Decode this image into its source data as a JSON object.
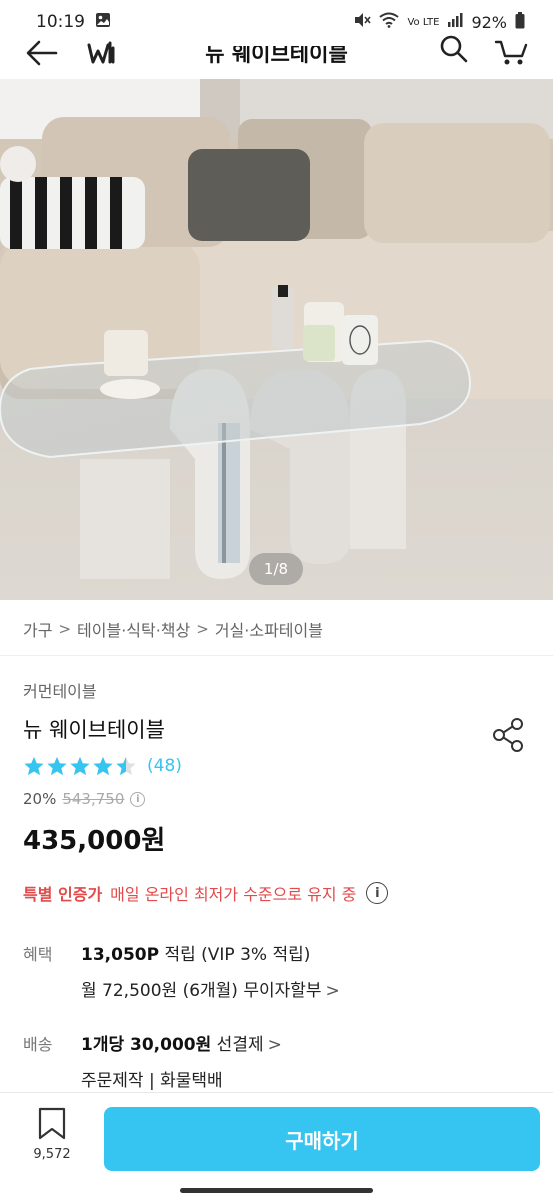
{
  "status_bar": {
    "time": "10:19",
    "network": "Vo LTE",
    "battery": "92%"
  },
  "header": {
    "title": "뉴 웨이브테이블",
    "icons": [
      "back-arrow-icon",
      "ohouse-logo-icon",
      "search-icon",
      "cart-icon"
    ]
  },
  "hero": {
    "pager": "1/8"
  },
  "breadcrumb": {
    "items": [
      "가구",
      "테이블·식탁·책상",
      "거실·소파테이블"
    ],
    "separator": ">"
  },
  "product": {
    "brand": "커먼테이블",
    "name": "뉴 웨이브테이블",
    "rating": 4.5,
    "review_count": "(48)",
    "discount_rate": "20%",
    "original_price": "543,750",
    "sale_price": "435,000원"
  },
  "certification": {
    "label": "특별 인증가",
    "text": "매일 온라인 최저가 수준으로 유지 중",
    "info_icon": "i"
  },
  "benefits": {
    "label": "혜택",
    "points": "13,050P",
    "points_suffix": " 적립 (VIP 3% 적립)",
    "installment": "월 72,500원 (6개월) 무이자할부",
    "chevron": ">"
  },
  "shipping": {
    "label": "배송",
    "fee": "1개당 30,000원",
    "fee_suffix": " 선결제",
    "method": "주문제작 | 화물택배",
    "chevron": ">"
  },
  "bottom_bar": {
    "bookmark_count": "9,572",
    "buy_label": "구매하기"
  },
  "colors": {
    "accent": "#35c5f0",
    "star": "#35c5f0",
    "cert": "#e34a4a"
  }
}
